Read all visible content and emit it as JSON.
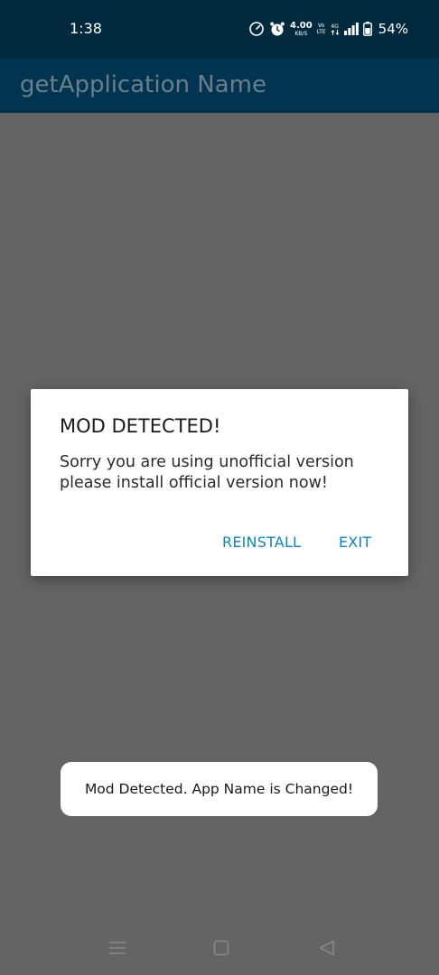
{
  "status_bar": {
    "time": "1:38",
    "network_speed_value": "4.00",
    "network_speed_unit": "KB/S",
    "volte_top": "Vo",
    "volte_bottom": "LTE",
    "network_type": "4G",
    "battery_percent": "54%"
  },
  "app_bar": {
    "title": "getApplication Name"
  },
  "dialog": {
    "title": "MOD DETECTED!",
    "message": "Sorry you are using unofficial version please install official version now!",
    "reinstall_label": "REINSTALL",
    "exit_label": "EXIT"
  },
  "toast": {
    "message": "Mod Detected. App Name is Changed!"
  },
  "nav_bar": {
    "icons": [
      "menu-icon",
      "home-square-icon",
      "back-triangle-icon"
    ]
  },
  "colors": {
    "status_bar_bg": "#012a3e",
    "app_bar_bg": "#003450",
    "scrim_bg": "#646464",
    "accent": "#0b86c0"
  }
}
